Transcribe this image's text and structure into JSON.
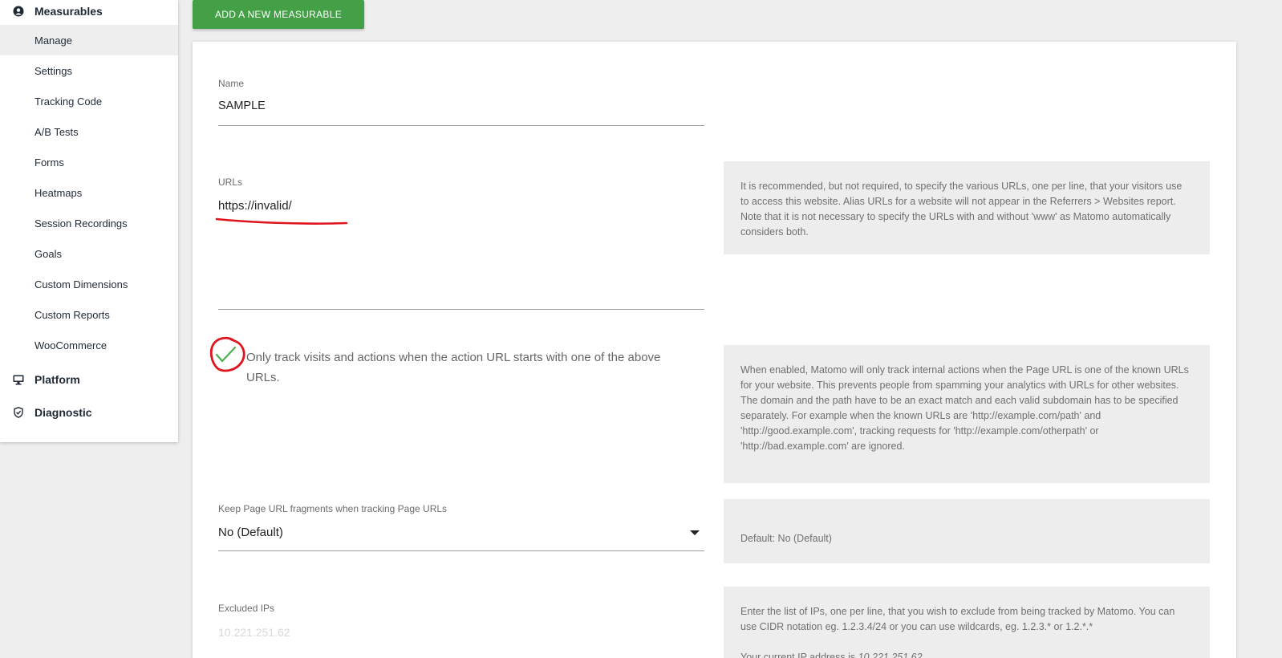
{
  "sidebar": {
    "sections": [
      {
        "label": "Measurables",
        "icon": "person-circle-icon"
      },
      {
        "label": "Platform",
        "icon": "monitor-icon"
      },
      {
        "label": "Diagnostic",
        "icon": "shield-check-icon"
      }
    ],
    "items": [
      {
        "label": "Manage"
      },
      {
        "label": "Settings"
      },
      {
        "label": "Tracking Code"
      },
      {
        "label": "A/B Tests"
      },
      {
        "label": "Forms"
      },
      {
        "label": "Heatmaps"
      },
      {
        "label": "Session Recordings"
      },
      {
        "label": "Goals"
      },
      {
        "label": "Custom Dimensions"
      },
      {
        "label": "Custom Reports"
      },
      {
        "label": "WooCommerce"
      }
    ]
  },
  "toolbar": {
    "add_label": "ADD A NEW MEASURABLE"
  },
  "form": {
    "name": {
      "label": "Name",
      "value": "SAMPLE"
    },
    "urls": {
      "label": "URLs",
      "value": "https://invalid/",
      "help": "It is recommended, but not required, to specify the various URLs, one per line, that your visitors use to access this website. Alias URLs for a website will not appear in the Referrers > Websites report. Note that it is not necessary to specify the URLs with and without 'www' as Matomo automatically considers both."
    },
    "only_track": {
      "label_line1": "Only track visits and actions when the action URL starts with one of the above",
      "label_line2": "URLs.",
      "help_p1": "When enabled, Matomo will only track internal actions when the Page URL is one of the known URLs for your website. This prevents people from spamming your analytics with URLs for other websites.",
      "help_p2": "The domain and the path have to be an exact match and each valid subdomain has to be specified separately. For example when the known URLs are 'http://example.com/path' and 'http://good.example.com', tracking requests for 'http://example.com/otherpath' or 'http://bad.example.com' are ignored."
    },
    "fragments": {
      "label": "Keep Page URL fragments when tracking Page URLs",
      "value": "No (Default)",
      "help": "Default: No (Default)"
    },
    "excluded_ips": {
      "label": "Excluded IPs",
      "placeholder": "10.221.251.62",
      "help_line1": "Enter the list of IPs, one per line, that you wish to exclude from being tracked by Matomo. You can use CIDR notation eg. 1.2.3.4/24 or you can use wildcards, eg. 1.2.3.* or 1.2.*.*",
      "help_ip_prefix": "Your current IP address is ",
      "help_ip_value": "10.221.251.62"
    }
  },
  "colors": {
    "accent": "#43a047",
    "annotation": "#e0141e",
    "check": "#4caf50"
  }
}
